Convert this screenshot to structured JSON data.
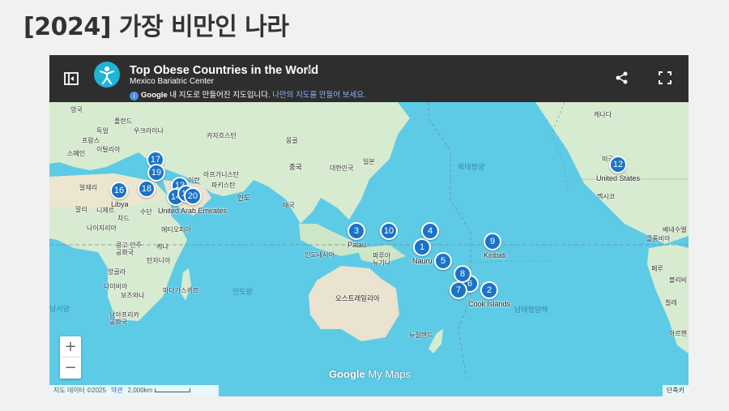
{
  "page": {
    "title": "[2024] 가장 비만인 나라"
  },
  "map": {
    "title": "Top Obese Countries in the World",
    "subtitle": "Mexico Bariatric Center",
    "info_icon": "i",
    "info_google": "Google",
    "info_text": " 내 지도로 만들어진 지도입니다. ",
    "info_link": "나만의 지도를 만들어 보세요.",
    "icons": {
      "panel": "panel-toggle-icon",
      "share": "share-icon",
      "fullscreen": "fullscreen-icon",
      "logo": "person-logo-icon",
      "star": "star-icon"
    },
    "zoom_in": "+",
    "zoom_out": "−",
    "attribution": "지도 데이터 ©2025",
    "terms": "약관",
    "scale": "2,000km",
    "shortcuts": "단축키",
    "brand_google": "Google",
    "brand_mymaps": " My Maps",
    "colors": {
      "water": "#5dcbe6",
      "land": "#d7ebd0",
      "marker": "#1a73c9",
      "header": "#2e2e2e"
    }
  },
  "labels": {
    "uk": "영국",
    "poland": "폴란드",
    "germany": "독일",
    "ukraine": "우크라이나",
    "france": "프랑스",
    "italy": "이탈리아",
    "spain": "스페인",
    "kazakhstan": "카자흐스탄",
    "mongolia": "몽골",
    "china": "중국",
    "korea": "대한민국",
    "japan": "일본",
    "afghanistan": "아프가니스탄",
    "iran": "이란",
    "pakistan": "파키스탄",
    "india": "인도",
    "thailand": "태국",
    "algeria": "알제리",
    "mali": "말리",
    "niger": "니제르",
    "chad": "차드",
    "sudan": "수단",
    "nigeria": "나이지리아",
    "ethiopia": "에티오피아",
    "drc": "콩고 민주\n공화국",
    "kenya": "케냐",
    "tanzania": "탄자니아",
    "angola": "앙골라",
    "namibia": "나미비아",
    "botswana": "보츠와나",
    "madagascar": "마다가스카르",
    "southafrica": "남아프리카\n공화국",
    "indonesia": "인도네시아",
    "png": "파푸아\n뉴기니",
    "australia": "오스트레일리아",
    "newzealand": "뉴질랜드",
    "canada": "캐나다",
    "usa": "미국",
    "mexico": "멕시코",
    "venezuela": "베네수엘",
    "colombia": "콜롬비아",
    "peru": "페루",
    "bolivia": "볼리비",
    "chile": "칠레",
    "argentina": "아르헨",
    "north_pacific": "북태평양",
    "south_pacific": "남태평양해",
    "indian_ocean": "인도양",
    "south_atlantic": "남서양"
  },
  "pins": [
    {
      "num": "1",
      "place": "Nauru"
    },
    {
      "num": "2",
      "place": "Cook Islands"
    },
    {
      "num": "3",
      "place": "Palau"
    },
    {
      "num": "4",
      "place": ""
    },
    {
      "num": "5",
      "place": ""
    },
    {
      "num": "6",
      "place": ""
    },
    {
      "num": "7",
      "place": ""
    },
    {
      "num": "8",
      "place": ""
    },
    {
      "num": "9",
      "place": "Kiribati"
    },
    {
      "num": "10",
      "place": ""
    },
    {
      "num": "12",
      "place": "United States"
    },
    {
      "num": "13",
      "place": ""
    },
    {
      "num": "14",
      "place": ""
    },
    {
      "num": "15",
      "place": "United Arab Emirates"
    },
    {
      "num": "16",
      "place": "Libya"
    },
    {
      "num": "17",
      "place": ""
    },
    {
      "num": "18",
      "place": ""
    },
    {
      "num": "19",
      "place": ""
    },
    {
      "num": "20",
      "place": ""
    }
  ]
}
